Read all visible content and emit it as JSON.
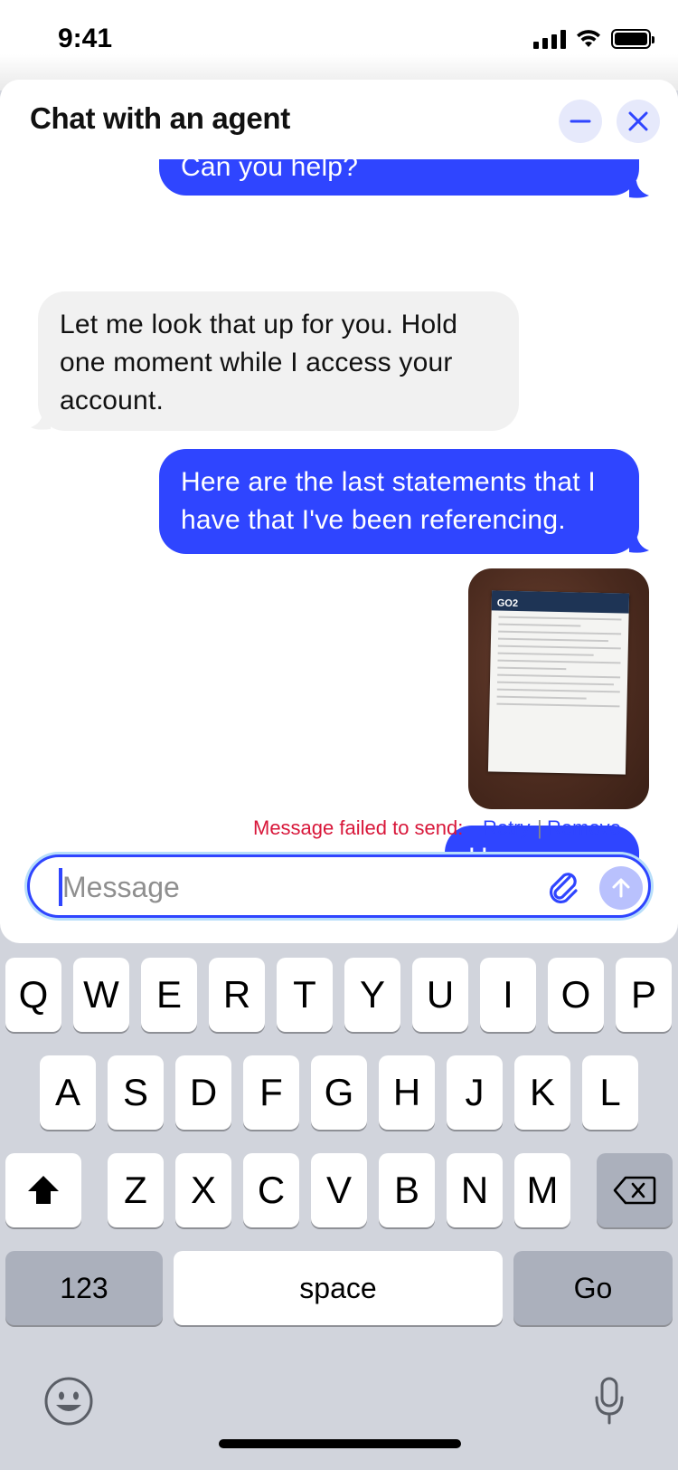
{
  "status_bar": {
    "time": "9:41"
  },
  "chat": {
    "title": "Chat with an agent",
    "messages": [
      {
        "sender": "user",
        "text": "Can you help?"
      },
      {
        "sender": "agent",
        "text": "Let me look that up for you. Hold one moment while I access your account."
      },
      {
        "sender": "user",
        "text": "Here are the last statements that I have that I've been referencing."
      },
      {
        "sender": "user",
        "type": "image",
        "description_icon": "bank-statement-photo",
        "brand": "GO2"
      },
      {
        "sender": "user",
        "text": "Here you go"
      }
    ],
    "error": {
      "text": "Message failed to send:",
      "retry_label": "Retry",
      "separator": "|",
      "remove_label": "Remove"
    },
    "input": {
      "placeholder": "Message",
      "value": ""
    }
  },
  "keyboard": {
    "row1": [
      "Q",
      "W",
      "E",
      "R",
      "T",
      "Y",
      "U",
      "I",
      "O",
      "P"
    ],
    "row2": [
      "A",
      "S",
      "D",
      "F",
      "G",
      "H",
      "J",
      "K",
      "L"
    ],
    "row3": [
      "Z",
      "X",
      "C",
      "V",
      "B",
      "N",
      "M"
    ],
    "numbers_label": "123",
    "space_label": "space",
    "go_label": "Go"
  },
  "colors": {
    "accent": "#2f45ff",
    "error": "#d8173a",
    "agent_bubble": "#f1f1f1"
  }
}
